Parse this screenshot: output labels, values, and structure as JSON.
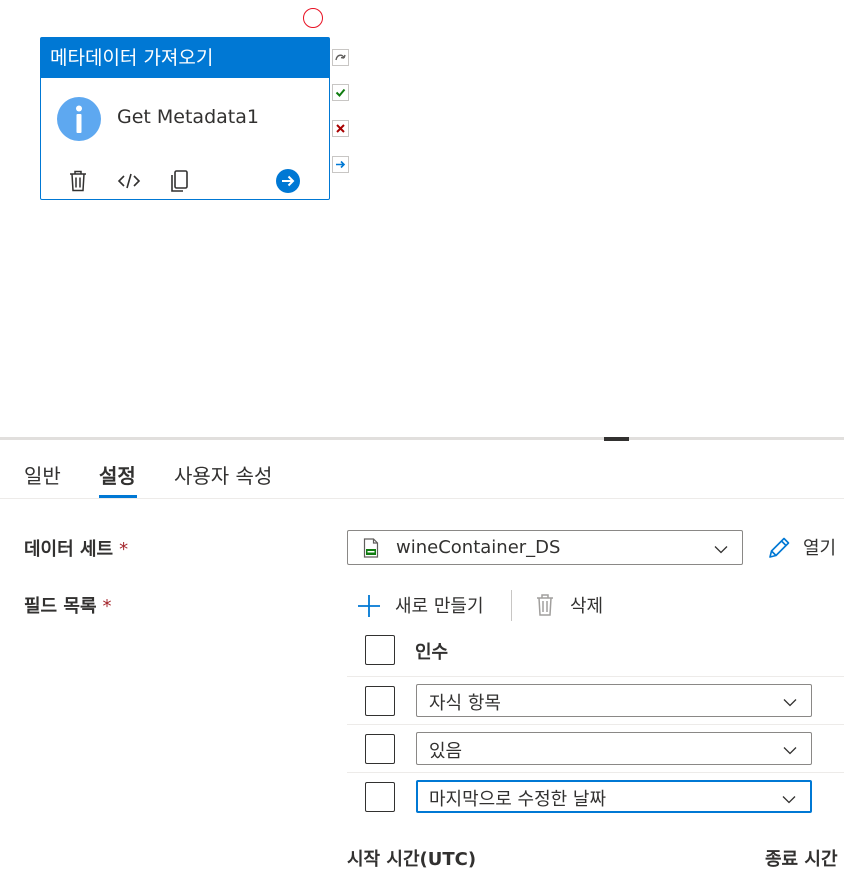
{
  "activity": {
    "type_label": "메타데이터 가져오기",
    "name": "Get Metadata1",
    "header_color": "#0078d4"
  },
  "tabs": [
    {
      "label": "일반"
    },
    {
      "label": "설정",
      "active": true
    },
    {
      "label": "사용자 속성"
    }
  ],
  "form": {
    "dataset_label": "데이터 세트",
    "fields_label": "필드 목록",
    "required_mark": "*",
    "dataset_value": "wineContainer_DS",
    "open_label": "열기"
  },
  "toolbar": {
    "new_label": "새로 만들기",
    "delete_label": "삭제"
  },
  "arguments": {
    "header": "인수",
    "rows": [
      {
        "value": "자식 항목"
      },
      {
        "value": "있음"
      },
      {
        "value": "마지막으로 수정한 날짜",
        "focused": true
      }
    ]
  },
  "run_table": {
    "start_time_header": "시작 시간(UTC)",
    "end_time_header": "종료 시간"
  },
  "colors": {
    "accent": "#0078d4",
    "success": "#107c10",
    "failure": "#a80000",
    "required": "#a4262c"
  }
}
